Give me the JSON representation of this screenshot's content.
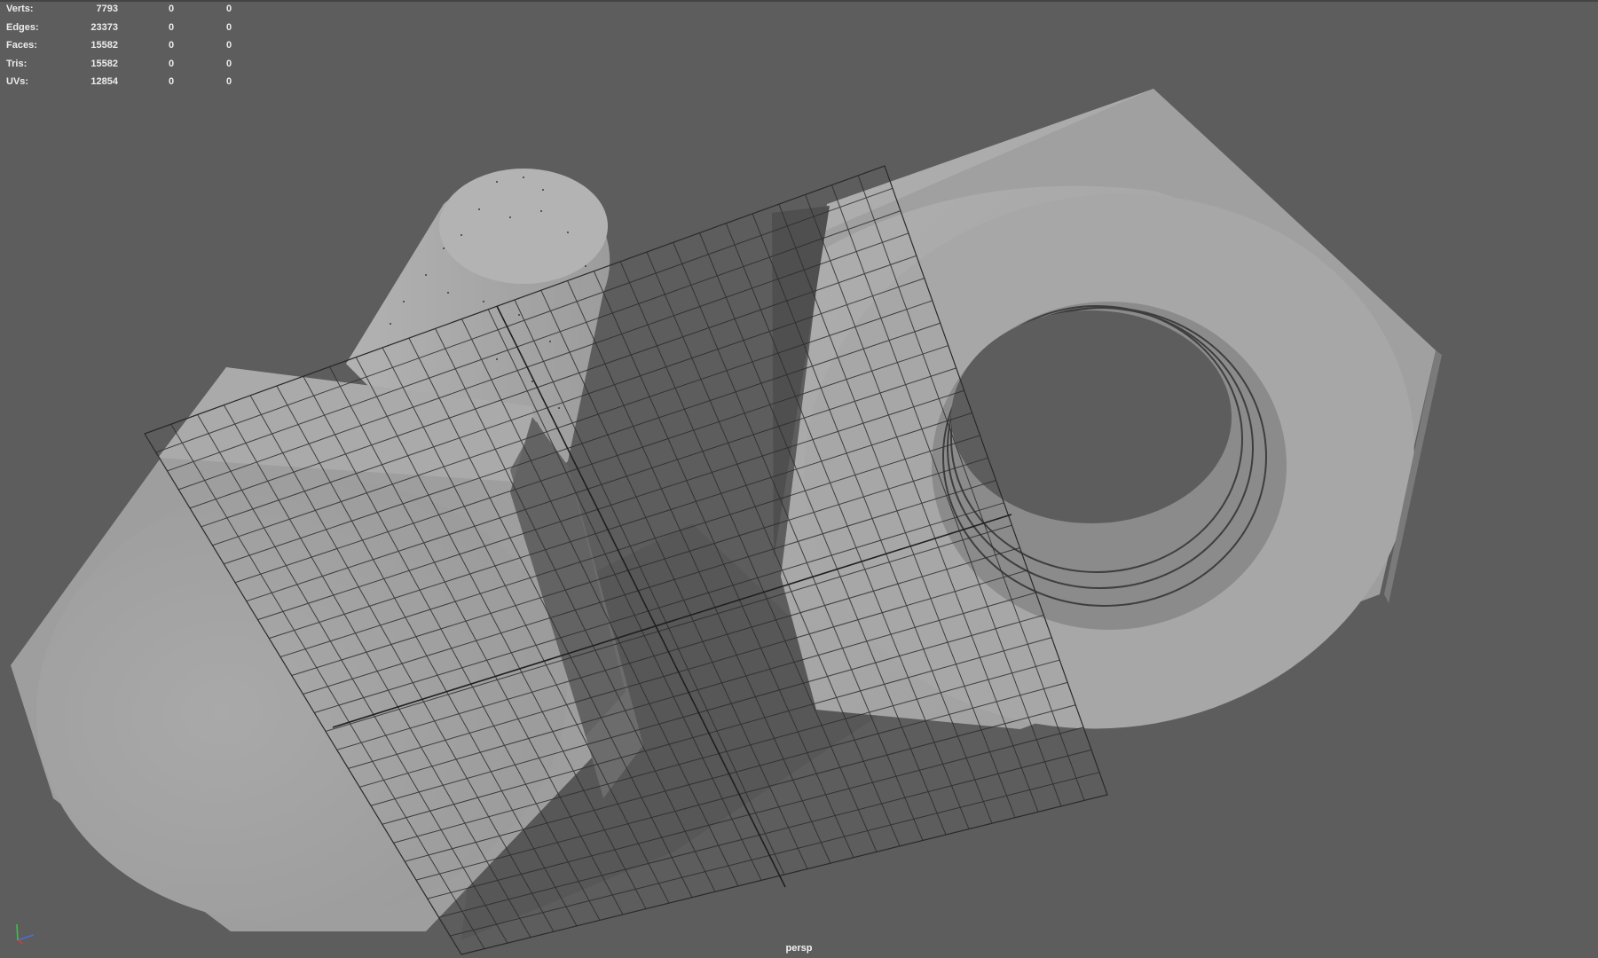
{
  "hud": {
    "rows": [
      {
        "label": "Verts:",
        "total": "7793",
        "selected": "0",
        "components": "0"
      },
      {
        "label": "Edges:",
        "total": "23373",
        "selected": "0",
        "components": "0"
      },
      {
        "label": "Faces:",
        "total": "15582",
        "selected": "0",
        "components": "0"
      },
      {
        "label": "Tris:",
        "total": "15582",
        "selected": "0",
        "components": "0"
      },
      {
        "label": "UVs:",
        "total": "12854",
        "selected": "0",
        "components": "0"
      }
    ]
  },
  "viewport": {
    "camera": "persp"
  },
  "colors": {
    "background": "#5d5d5d",
    "mesh": "#a6a6a6",
    "grid": "#2c2c2c"
  }
}
